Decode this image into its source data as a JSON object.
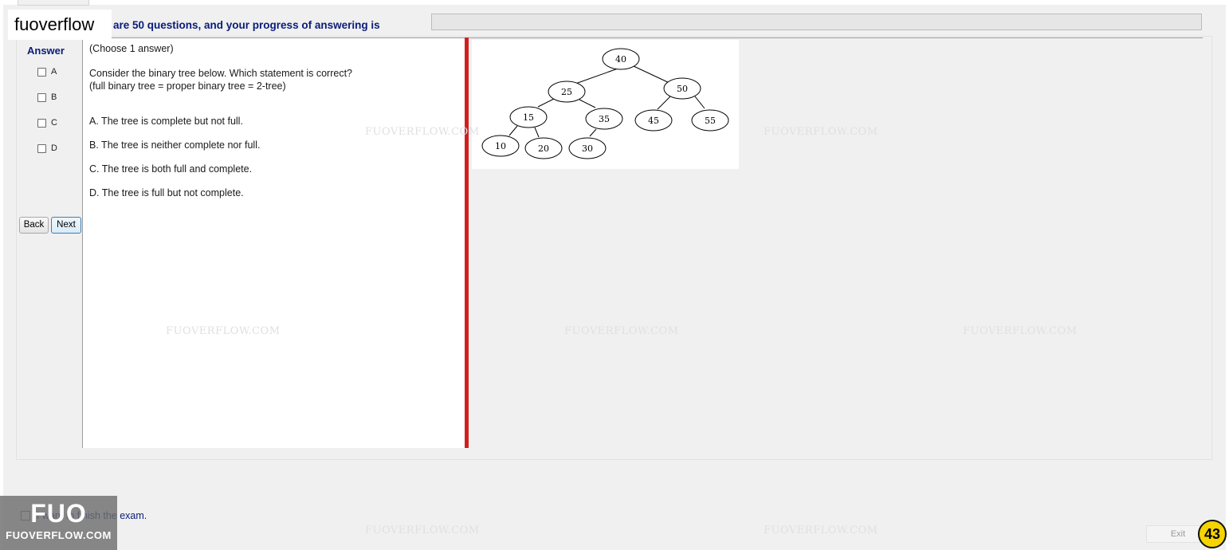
{
  "header": {
    "progress_text": "are 50 questions, and your progress of answering is",
    "progress_value": 0
  },
  "watermark": {
    "top_label": "fuoverflow",
    "logo_big": "FUO",
    "logo_small": "FUOVERFLOW.COM",
    "tile_text": "FUOVERFLOW.COM"
  },
  "answer_panel": {
    "title": "Answer",
    "options": [
      "A",
      "B",
      "C",
      "D"
    ],
    "back_label": "Back",
    "next_label": "Next"
  },
  "question": {
    "instruction": "(Choose 1 answer)",
    "text": "Consider the binary tree below. Which statement is correct? (full binary tree = proper binary tree = 2-tree)",
    "choices": [
      "A.  The tree is complete but not full.",
      "B.  The tree is neither complete nor full.",
      "C.  The tree is both full and complete.",
      "D.  The tree is full but not complete."
    ]
  },
  "tree": {
    "nodes": [
      "40",
      "25",
      "50",
      "15",
      "35",
      "45",
      "55",
      "10",
      "20",
      "30"
    ]
  },
  "footer": {
    "finish_text": "I want to finish the exam.",
    "exit_label": "Exit",
    "page_badge": "43"
  },
  "colors": {
    "header_text": "#0a1c7a",
    "splitter": "#d01f1f",
    "badge": "#f5d400"
  }
}
